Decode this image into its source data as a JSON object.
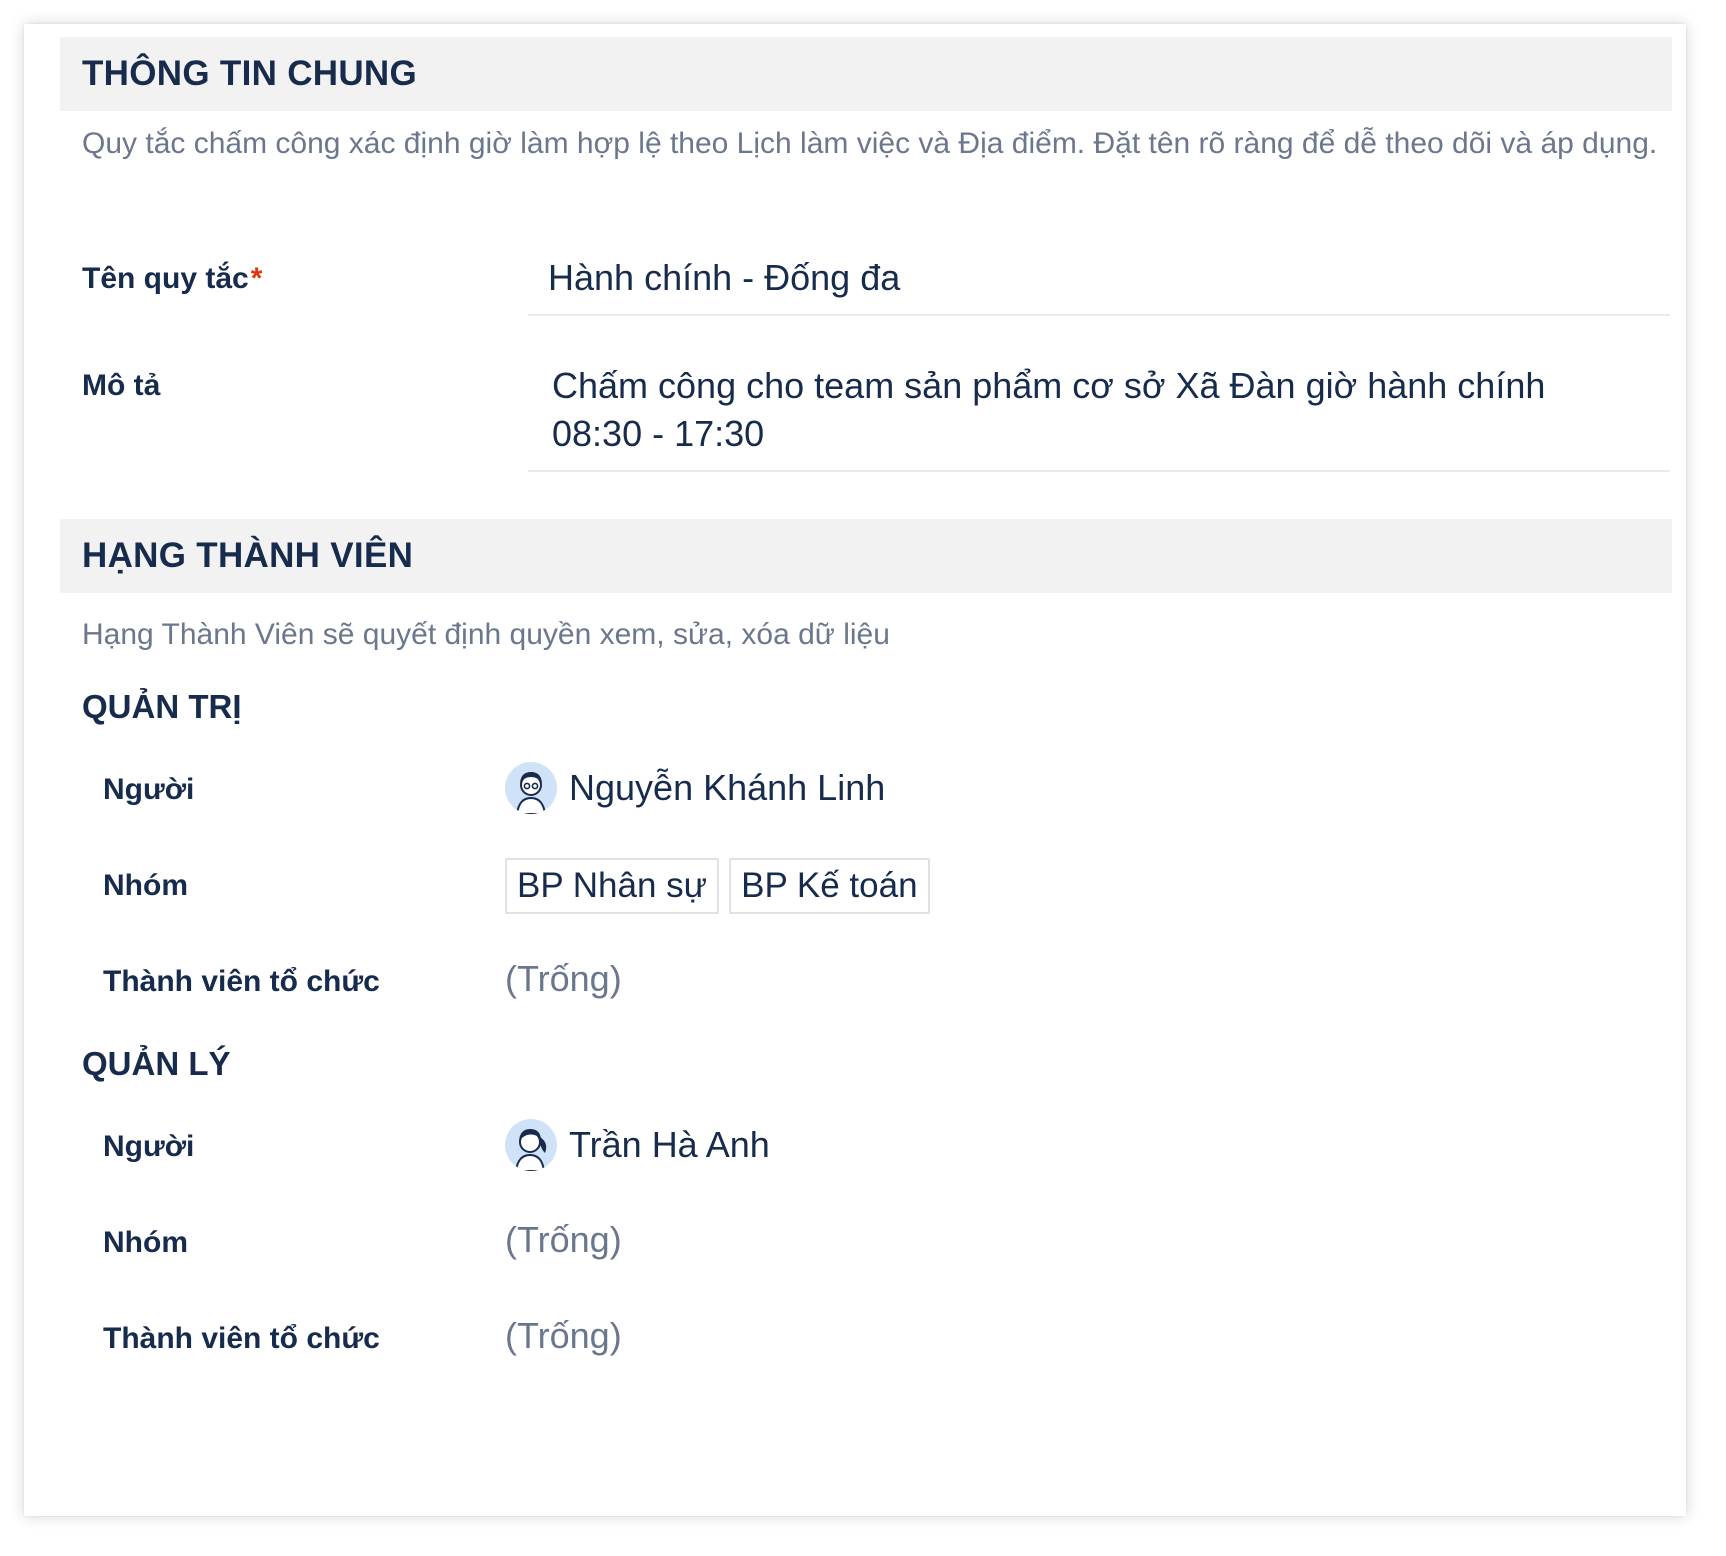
{
  "general": {
    "title": "THÔNG TIN CHUNG",
    "description": "Quy tắc chấm công xác định giờ làm hợp lệ theo Lịch làm việc và Địa điểm. Đặt tên rõ ràng để dễ theo dõi và áp dụng.",
    "name_label": "Tên quy tắc",
    "required_mark": "*",
    "name_value": "Hành chính - Đống đa",
    "desc_label": "Mô tả",
    "desc_value": "Chấm công cho team sản phẩm cơ sở Xã Đàn giờ hành chính 08:30 - 17:30"
  },
  "membership": {
    "title": "HẠNG THÀNH VIÊN",
    "description": "Hạng Thành Viên sẽ quyết định quyền xem, sửa, xóa dữ liệu",
    "admin": {
      "title": "QUẢN TRỊ",
      "person_label": "Người",
      "person_value": "Nguyễn Khánh Linh",
      "person_avatar_icon": "avatar-woman-glasses-icon",
      "group_label": "Nhóm",
      "groups": [
        "BP Nhân sự",
        "BP Kế toán"
      ],
      "org_label": "Thành viên tổ chức",
      "org_value": "(Trống)"
    },
    "manager": {
      "title": "QUẢN LÝ",
      "person_label": "Người",
      "person_value": "Trần Hà Anh",
      "person_avatar_icon": "avatar-woman-ponytail-icon",
      "group_label": "Nhóm",
      "group_value": "(Trống)",
      "org_label": "Thành viên tổ chức",
      "org_value": "(Trống)"
    }
  },
  "colors": {
    "text": "#172b4d",
    "muted": "#6b778c",
    "required": "#de350b",
    "header_bg": "#f2f2f2",
    "avatar_bg": "#cfe2f8"
  }
}
